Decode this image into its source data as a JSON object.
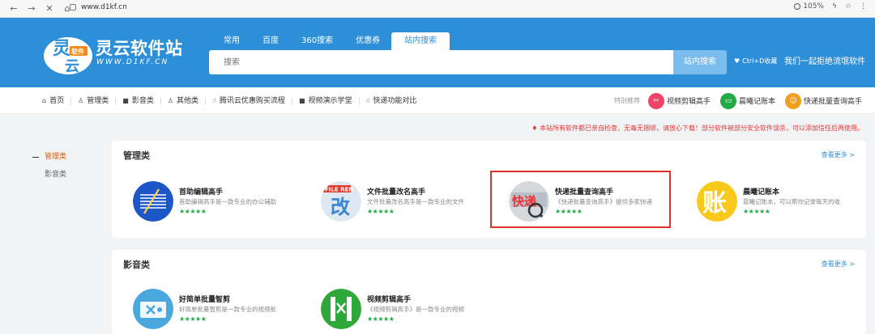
{
  "browser": {
    "back_icon": "back-arrow-icon",
    "forward_icon": "forward-arrow-icon",
    "close_icon": "close-icon",
    "home_icon": "home-icon",
    "url": "www.d1kf.cn",
    "zoom": "105%",
    "bolt_icon": "bolt-icon",
    "star_icon": "star-icon"
  },
  "header": {
    "logo_badge_top": "灵",
    "logo_badge_mid": "软件",
    "logo_badge_bottom": "云",
    "logo_name": "灵云软件站",
    "logo_site": "WWW.D1KF.CN",
    "tabs": [
      "常用",
      "百度",
      "360搜索",
      "优惠券",
      "站内搜索"
    ],
    "active_tab": 4,
    "search_placeholder": "搜索",
    "search_button": "站内搜索",
    "bookmark_text": "Ctrl+D收藏",
    "slogan": "我们一起拒绝流氓软件"
  },
  "subnav": {
    "items": [
      {
        "icon": "home-icon",
        "glyph": "⌂",
        "label": "首页"
      },
      {
        "icon": "user-icon",
        "glyph": "♙",
        "label": "管理类"
      },
      {
        "icon": "video-icon",
        "glyph": "■",
        "label": "影音类"
      },
      {
        "icon": "user-icon",
        "glyph": "♙",
        "label": "其他类"
      },
      {
        "icon": "thumb-icon",
        "glyph": "☝",
        "label": "腾讯云优惠购买流程"
      },
      {
        "icon": "video-icon",
        "glyph": "■",
        "label": "视频演示学堂"
      },
      {
        "icon": "thumb-icon",
        "glyph": "☝",
        "label": "快递功能对比"
      }
    ],
    "recommend_label": "特别推荐",
    "recommend": [
      {
        "label": "视频剪辑高手",
        "color": "#ee4466",
        "glyph": "✂"
      },
      {
        "label": "晨曦记账本",
        "color": "#22aa44",
        "glyph": "▭"
      },
      {
        "label": "快递批量查询高手",
        "color": "#f0a020",
        "glyph": "☺"
      }
    ]
  },
  "notice": "本站所有软件都已亲自检查，无毒无捆绑，请放心下载！部分软件被部分安全软件误杀，可以添加信任后再使用。",
  "sidebar": {
    "items": [
      "管理类",
      "影音类"
    ],
    "active": 0
  },
  "sections": [
    {
      "title": "管理类",
      "more": "查看更多 >",
      "apps": [
        {
          "name": "首助编辑高手",
          "desc": "首助编辑高手是一款专业的办公辅助",
          "stars": "★★★★★",
          "icon": "editor-icon"
        },
        {
          "name": "文件批量改名高手",
          "desc": "文件批量改名高手是一款专业的文件",
          "stars": "★★★★★",
          "icon": "rename-icon",
          "badge": "FILE REN",
          "glyph": "改"
        },
        {
          "name": "快递批量查询高手",
          "desc": "《快递批量查询高手》提供多家快递",
          "stars": "★★★★★",
          "icon": "express-icon",
          "glyph": "快递"
        },
        {
          "name": "晨曦记账本",
          "desc": "晨曦记账本，可以帮你记录每天的收",
          "stars": "★★★★★",
          "icon": "account-book-icon",
          "glyph": "账"
        }
      ]
    },
    {
      "title": "影音类",
      "more": "查看更多 >",
      "apps": [
        {
          "name": "好简单批量智剪",
          "desc": "好简单批量智剪是一款专业的视频批",
          "stars": "★★★★★",
          "icon": "smart-cut-icon"
        },
        {
          "name": "视频剪辑高手",
          "desc": "《视频剪辑高手》是一款专业的视频",
          "stars": "★★★★★",
          "icon": "video-editor-icon"
        }
      ]
    }
  ],
  "colors": {
    "header_blue": "#2d8fd8",
    "accent_orange": "#e05a00",
    "star_green": "#22aa44",
    "notice_red": "#e33333",
    "highlight_red": "#e0302a"
  }
}
